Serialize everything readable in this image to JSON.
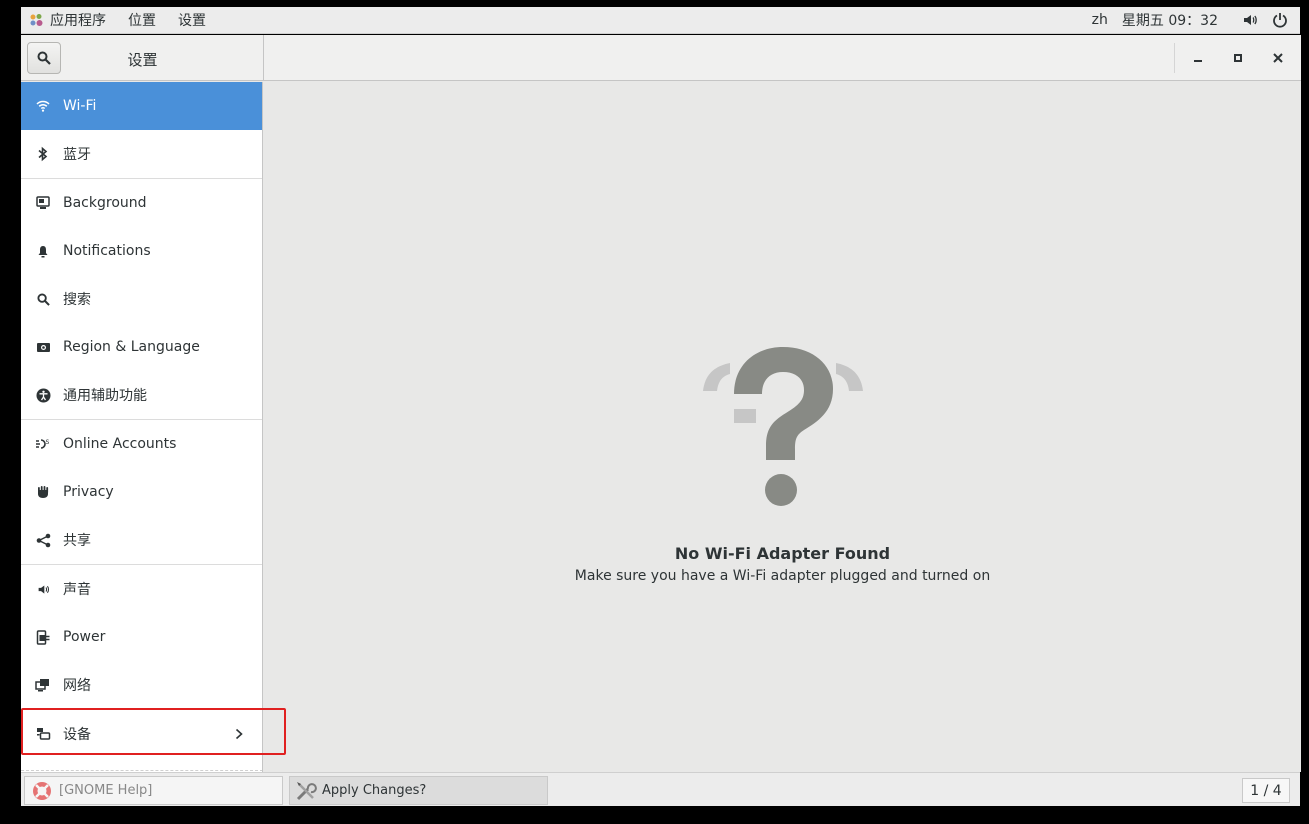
{
  "topbar": {
    "menus": [
      "应用程序",
      "位置",
      "设置"
    ],
    "input_method": "zh",
    "clock": "星期五 09：32"
  },
  "window": {
    "title": "设置"
  },
  "sidebar": {
    "items": [
      {
        "label": "Wi-Fi",
        "icon": "wifi-icon"
      },
      {
        "label": "蓝牙",
        "icon": "bluetooth-icon"
      },
      {
        "label": "Background",
        "icon": "background-icon"
      },
      {
        "label": "Notifications",
        "icon": "bell-icon"
      },
      {
        "label": "搜索",
        "icon": "search-icon"
      },
      {
        "label": "Region & Language",
        "icon": "camera-icon"
      },
      {
        "label": "通用辅助功能",
        "icon": "accessibility-icon"
      },
      {
        "label": "Online Accounts",
        "icon": "online-accounts-icon"
      },
      {
        "label": "Privacy",
        "icon": "hand-icon"
      },
      {
        "label": "共享",
        "icon": "share-icon"
      },
      {
        "label": "声音",
        "icon": "speaker-icon"
      },
      {
        "label": "Power",
        "icon": "power-plug-icon"
      },
      {
        "label": "网络",
        "icon": "network-icon"
      },
      {
        "label": "设备",
        "icon": "devices-icon"
      }
    ],
    "selected": "Wi-Fi"
  },
  "content": {
    "title": "No Wi-Fi Adapter Found",
    "subtitle": "Make sure you have a Wi-Fi adapter plugged and turned on"
  },
  "taskbar": {
    "tasks": [
      "[GNOME Help]",
      "Apply Changes?"
    ],
    "workspace": "1 / 4"
  },
  "colors": {
    "accent": "#4a90d9",
    "highlight_box": "#e02020"
  }
}
